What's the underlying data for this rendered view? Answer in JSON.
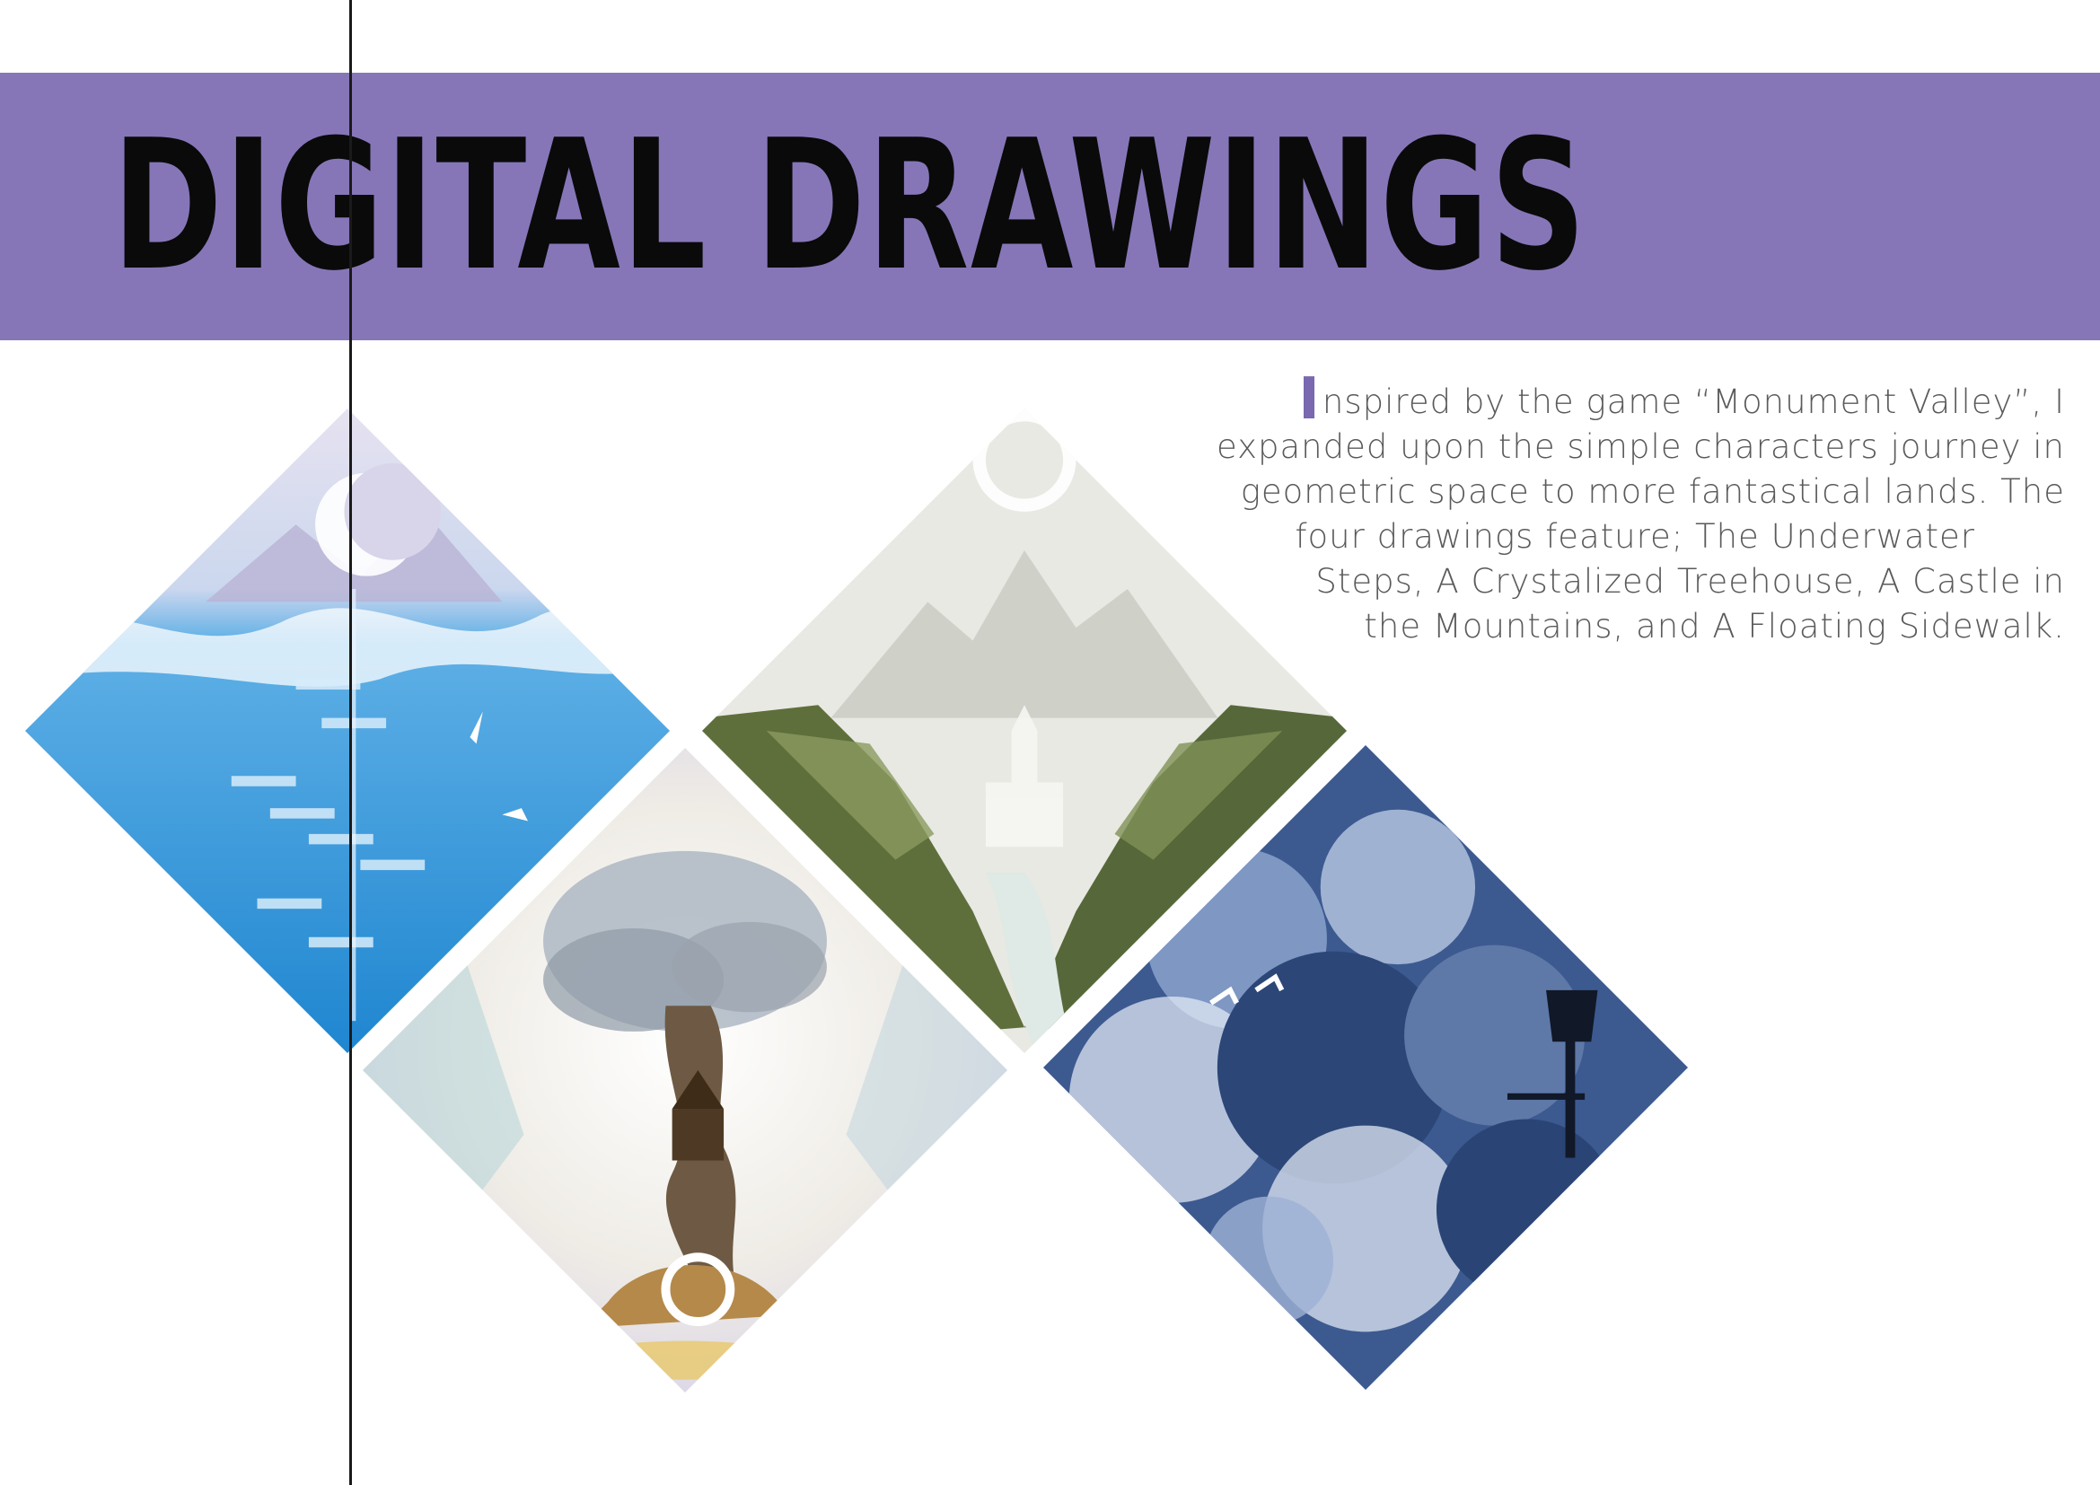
{
  "header": {
    "title": "DIGITAL DRAWINGS",
    "band_color": "#8676b8"
  },
  "intro": {
    "drop_cap": "I",
    "lines": [
      "nspired by the game “Monument Valley”, I",
      "expanded upon the simple characters journey in",
      "geometric space to more fantastical lands. The",
      "four drawings feature; The Underwater",
      "Steps, A Crystalized Treehouse, A Castle in",
      "the Mountains, and A Floating Sidewalk."
    ],
    "accent_color": "#7a68b0"
  },
  "artworks": [
    {
      "subject": "underwater-steps",
      "palette": [
        "#3b98d8",
        "#8cc8ee",
        "#e8e4f0"
      ]
    },
    {
      "subject": "castle-in-the-mountains",
      "palette": [
        "#e9eae4",
        "#5b6e3a",
        "#cfd3c8"
      ]
    },
    {
      "subject": "crystalized-treehouse",
      "palette": [
        "#f2efe8",
        "#8a6a3e",
        "#d9b45a"
      ]
    },
    {
      "subject": "floating-sidewalk",
      "palette": [
        "#2d4a7e",
        "#9fb3d6",
        "#e8eef6"
      ]
    }
  ]
}
